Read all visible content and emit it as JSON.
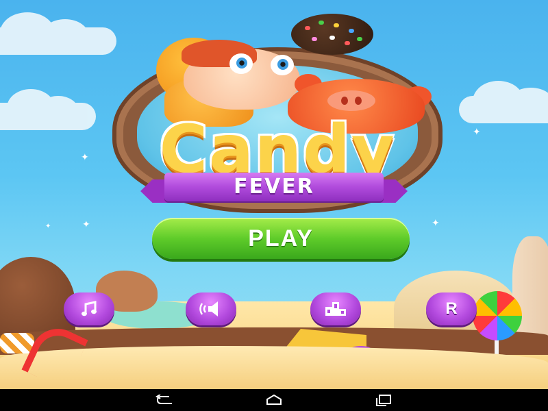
{
  "game": {
    "title_line1": "Candy",
    "title_line2": "FEVER",
    "play_label": "PLAY"
  },
  "menu_buttons": [
    {
      "id": "music",
      "icon": "music-note-icon"
    },
    {
      "id": "sound",
      "icon": "speaker-icon"
    },
    {
      "id": "leaderboard",
      "icon": "podium-icon"
    },
    {
      "id": "rate",
      "icon": "r-letter",
      "label": "R"
    }
  ],
  "android_nav": [
    {
      "id": "back",
      "icon": "back-icon"
    },
    {
      "id": "home",
      "icon": "home-icon"
    },
    {
      "id": "recents",
      "icon": "recents-icon"
    }
  ],
  "colors": {
    "play_green": "#5fcc2a",
    "button_purple": "#b44bdf",
    "ribbon_purple": "#b04bdc",
    "title_yellow": "#fcd34a",
    "sky_blue": "#4ab3ee"
  }
}
